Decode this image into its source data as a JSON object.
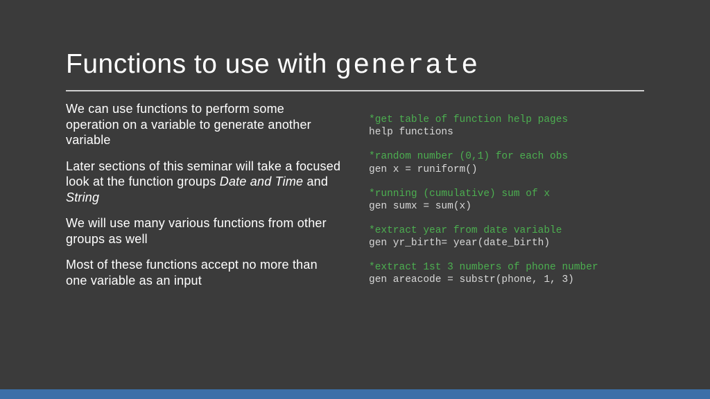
{
  "title": {
    "prefix": "Functions to use with ",
    "mono": "generate"
  },
  "left": {
    "p1": "We can use functions to perform some operation on a variable to generate another variable",
    "p2a": "Later sections of this seminar will take a focused look at the function groups ",
    "p2b": "Date and Time",
    "p2c": " and ",
    "p2d": "String",
    "p3": "We will use many various functions from other groups as well",
    "p4": "Most of these functions accept no more than one variable as an input"
  },
  "right": {
    "b1c": "*get table of function help pages",
    "b1x": "help functions",
    "b2c": "*random number (0,1) for each obs",
    "b2x": "gen x = runiform()",
    "b3c": "*running (cumulative) sum of x",
    "b3x": "gen sumx = sum(x)",
    "b4c": "*extract year from date variable",
    "b4x": "gen yr_birth= year(date_birth)",
    "b5c": "*extract 1st 3 numbers of phone number",
    "b5x": "gen areacode = substr(phone, 1, 3)"
  }
}
